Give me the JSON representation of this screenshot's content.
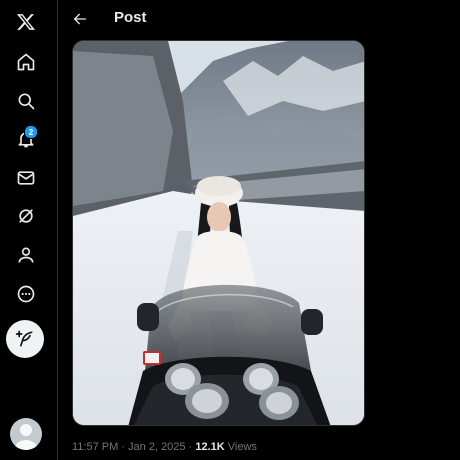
{
  "nav": {
    "items": [
      {
        "name": "x-logo-icon"
      },
      {
        "name": "home-icon"
      },
      {
        "name": "search-icon"
      },
      {
        "name": "notifications-icon",
        "badge": "2"
      },
      {
        "name": "messages-icon"
      },
      {
        "name": "grok-icon"
      },
      {
        "name": "profile-icon"
      },
      {
        "name": "more-icon"
      }
    ],
    "compose_icon": "feather-plus-icon"
  },
  "header": {
    "title": "Post"
  },
  "post": {
    "timestamp": "11:57 PM · Jan 2, 2025",
    "separator": "·",
    "views_count": "12.1K",
    "views_label": "Views"
  },
  "colors": {
    "accent": "#1d9bf0",
    "background": "#000000",
    "text": "#e7e9ea",
    "muted": "#71767b"
  }
}
